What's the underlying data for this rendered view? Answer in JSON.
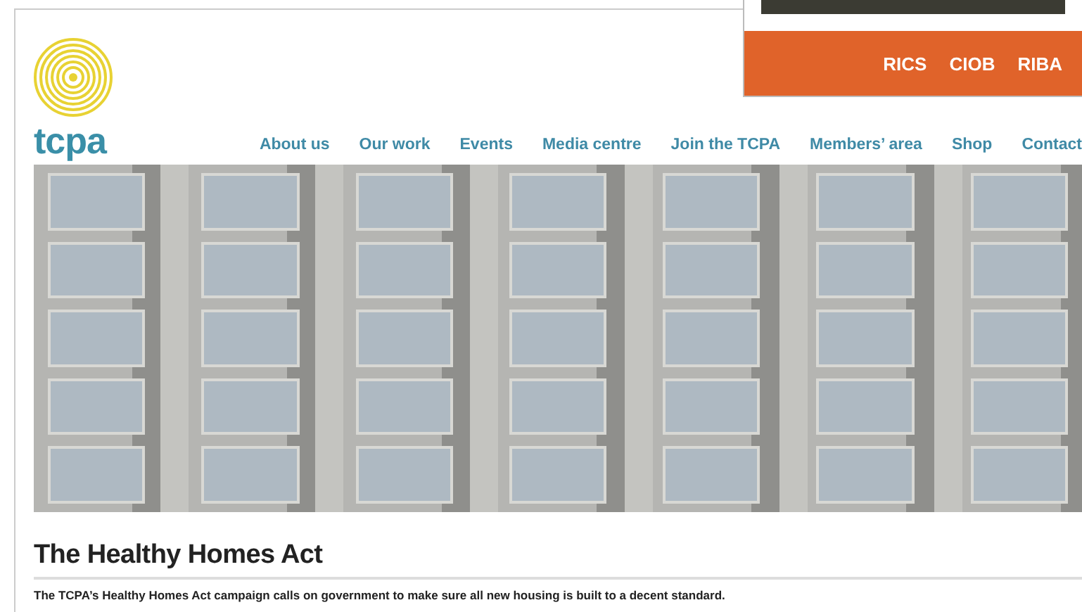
{
  "site": {
    "logo_text": "tcpa"
  },
  "nav": [
    "About us",
    "Our work",
    "Events",
    "Media centre",
    "Join the TCPA",
    "Members’ area",
    "Shop",
    "Contact"
  ],
  "ad": {
    "logos": [
      "RICS",
      "CIOB",
      "RIBA"
    ]
  },
  "article": {
    "title": "The Healthy Homes Act",
    "intro": "The TCPA’s Healthy Homes Act campaign calls on government to make sure all new housing is built to a decent standard."
  }
}
